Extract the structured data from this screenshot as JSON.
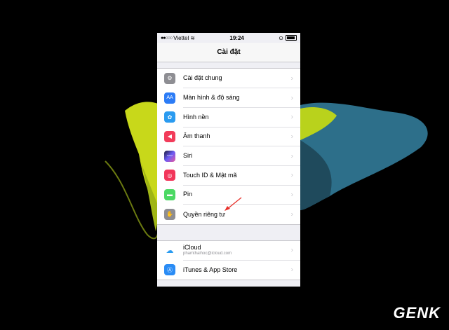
{
  "status_bar": {
    "carrier": "Viettel",
    "time": "19:24"
  },
  "nav": {
    "title": "Cài đặt"
  },
  "settings_group1": [
    {
      "label": "Cài đặt chung",
      "icon": "gear-icon",
      "color": "#8e8e93"
    },
    {
      "label": "Màn hình & độ sáng",
      "icon": "display-brightness-icon",
      "color": "#2c7cf6"
    },
    {
      "label": "Hình nền",
      "icon": "wallpaper-icon",
      "color": "#2a9bf0"
    },
    {
      "label": "Âm thanh",
      "icon": "sound-icon",
      "color": "#f23c5a"
    },
    {
      "label": "Siri",
      "icon": "siri-icon",
      "color": "#1c1c3a"
    },
    {
      "label": "Touch ID & Mật mã",
      "icon": "fingerprint-icon",
      "color": "#f2365a"
    },
    {
      "label": "Pin",
      "icon": "battery-icon",
      "color": "#4cd964"
    },
    {
      "label": "Quyền riêng tư",
      "icon": "privacy-hand-icon",
      "color": "#8e8e93"
    }
  ],
  "settings_group2": [
    {
      "label": "iCloud",
      "sublabel": "phamthaihoc@icloud.com",
      "icon": "icloud-icon",
      "color": "#ffffff"
    },
    {
      "label": "iTunes & App Store",
      "icon": "app-store-icon",
      "color": "#2a8cf5"
    }
  ],
  "watermark": "GENK"
}
